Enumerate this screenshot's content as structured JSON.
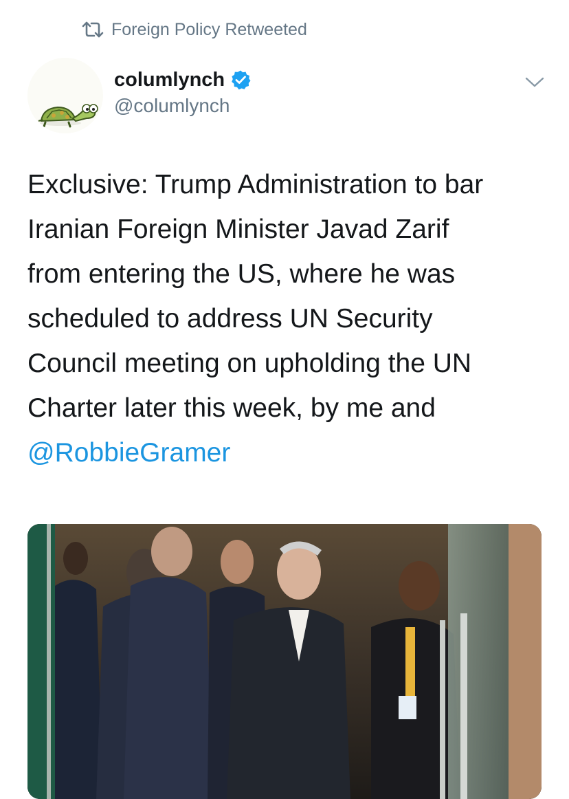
{
  "retweet_header": {
    "label": "Foreign Policy Retweeted",
    "icon": "retweet-icon"
  },
  "author": {
    "display_name": "columlynch",
    "handle": "@columlynch",
    "verified": true,
    "verified_icon": "verified-badge-icon",
    "avatar": "turtle-avatar"
  },
  "menu": {
    "icon": "chevron-down-icon"
  },
  "tweet": {
    "lines": [
      "Exclusive: Trump Administration to bar",
      "Iranian Foreign Minister Javad Zarif",
      "from entering the US, where he was",
      "scheduled to address UN Security",
      "Council meeting on upholding the UN",
      "Charter later this week, by me and"
    ],
    "mention": "@RobbieGramer"
  },
  "colors": {
    "link": "#1b95e0",
    "secondary_text": "#657786",
    "primary_text": "#14171a",
    "verified_badge": "#1da1f2"
  }
}
